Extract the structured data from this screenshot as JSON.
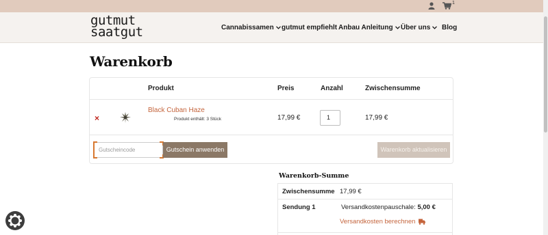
{
  "topbar": {
    "cart_count": "1",
    "user_icon": "user-icon",
    "cart_icon": "cart-icon"
  },
  "header": {
    "logo_line1": "gutmut",
    "logo_line2": "saatgut",
    "nav": [
      {
        "label": "Cannabissamen",
        "has_dropdown": true
      },
      {
        "label": "gutmut empfiehlt",
        "has_dropdown": false
      },
      {
        "label": "Anbau Anleitung",
        "has_dropdown": true
      },
      {
        "label": "Über uns",
        "has_dropdown": true
      },
      {
        "label": "Blog",
        "has_dropdown": false
      }
    ]
  },
  "page": {
    "title": "Warenkorb"
  },
  "cart": {
    "columns": {
      "product": "Produkt",
      "price": "Preis",
      "quantity": "Anzahl",
      "subtotal": "Zwischensumme"
    },
    "items": [
      {
        "name": "Black Cuban Haze",
        "meta": "Produkt enthält: 3 Stück",
        "price": "17,99 €",
        "quantity": "1",
        "subtotal": "17,99 €",
        "remove_symbol": "×"
      }
    ],
    "coupon_placeholder": "Gutscheincode",
    "apply_coupon_label": "Gutschein anwenden",
    "update_cart_label": "Warenkorb aktualisieren"
  },
  "totals": {
    "title": "Warenkorb-Summe",
    "subtotal_label": "Zwischensumme",
    "subtotal_value": "17,99 €",
    "shipping_label": "Sendung 1",
    "shipping_method": "Versandkostenpauschale:",
    "shipping_price": "5,00 €",
    "calc_shipping_label": "Versandkosten berechnen"
  },
  "colors": {
    "accent": "#c4643c",
    "topbar": "#e1cbbd",
    "button": "#8b7866",
    "button_disabled": "#d0c4ba",
    "remove": "#c0281f"
  }
}
